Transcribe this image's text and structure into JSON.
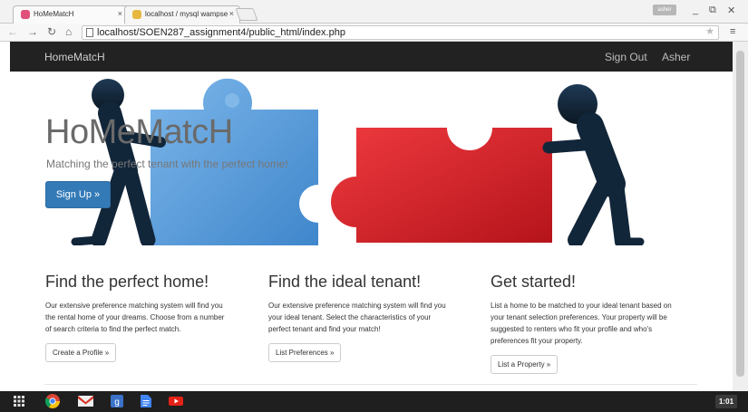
{
  "browser": {
    "tabs": [
      {
        "title": "HoMeMatcH",
        "favicon_color": "#e0507a"
      },
      {
        "title": "localhost / mysql wampse",
        "favicon_color": "#e6b840"
      }
    ],
    "user_chip": "asher",
    "url": "localhost/SOEN287_assignment4/public_html/index.php"
  },
  "navbar": {
    "brand": "HomeMatcH",
    "links": [
      "Sign Out",
      "Asher"
    ]
  },
  "hero": {
    "title": "HoMeMatcH",
    "subtitle": "Matching the perfect tenant with the perfect home!",
    "button": "Sign Up »",
    "colors": {
      "blue_piece": "#4d93d6",
      "red_piece": "#d8232b",
      "figure": "#0f1e2c",
      "accent": "#337ab7"
    }
  },
  "columns": [
    {
      "heading": "Find the perfect home!",
      "lines": [
        "Our extensive preference matching system will find you",
        "the rental home of your dreams. Choose from a number",
        "of search criteria to find the perfect match."
      ],
      "button": "Create a Profile »"
    },
    {
      "heading": "Find the ideal tenant!",
      "lines": [
        "Our extensive preference matching system will find you",
        "your ideal tenant. Select the characteristics of your",
        "perfect tenant and find your match!"
      ],
      "button": "List Preferences »"
    },
    {
      "heading": "Get started!",
      "lines": [
        "List a home to be matched to your ideal tenant based on",
        "your tenant selection preferences. Your property will be",
        "suggested to renters who fit your profile and who's",
        "preferences fit your property."
      ],
      "button": "List a Property »"
    }
  ],
  "taskbar": {
    "apps": [
      "launcher-icon",
      "chrome-icon",
      "gmail-icon",
      "google-plus-icon",
      "docs-icon",
      "youtube-icon"
    ],
    "clock": "1:01"
  }
}
